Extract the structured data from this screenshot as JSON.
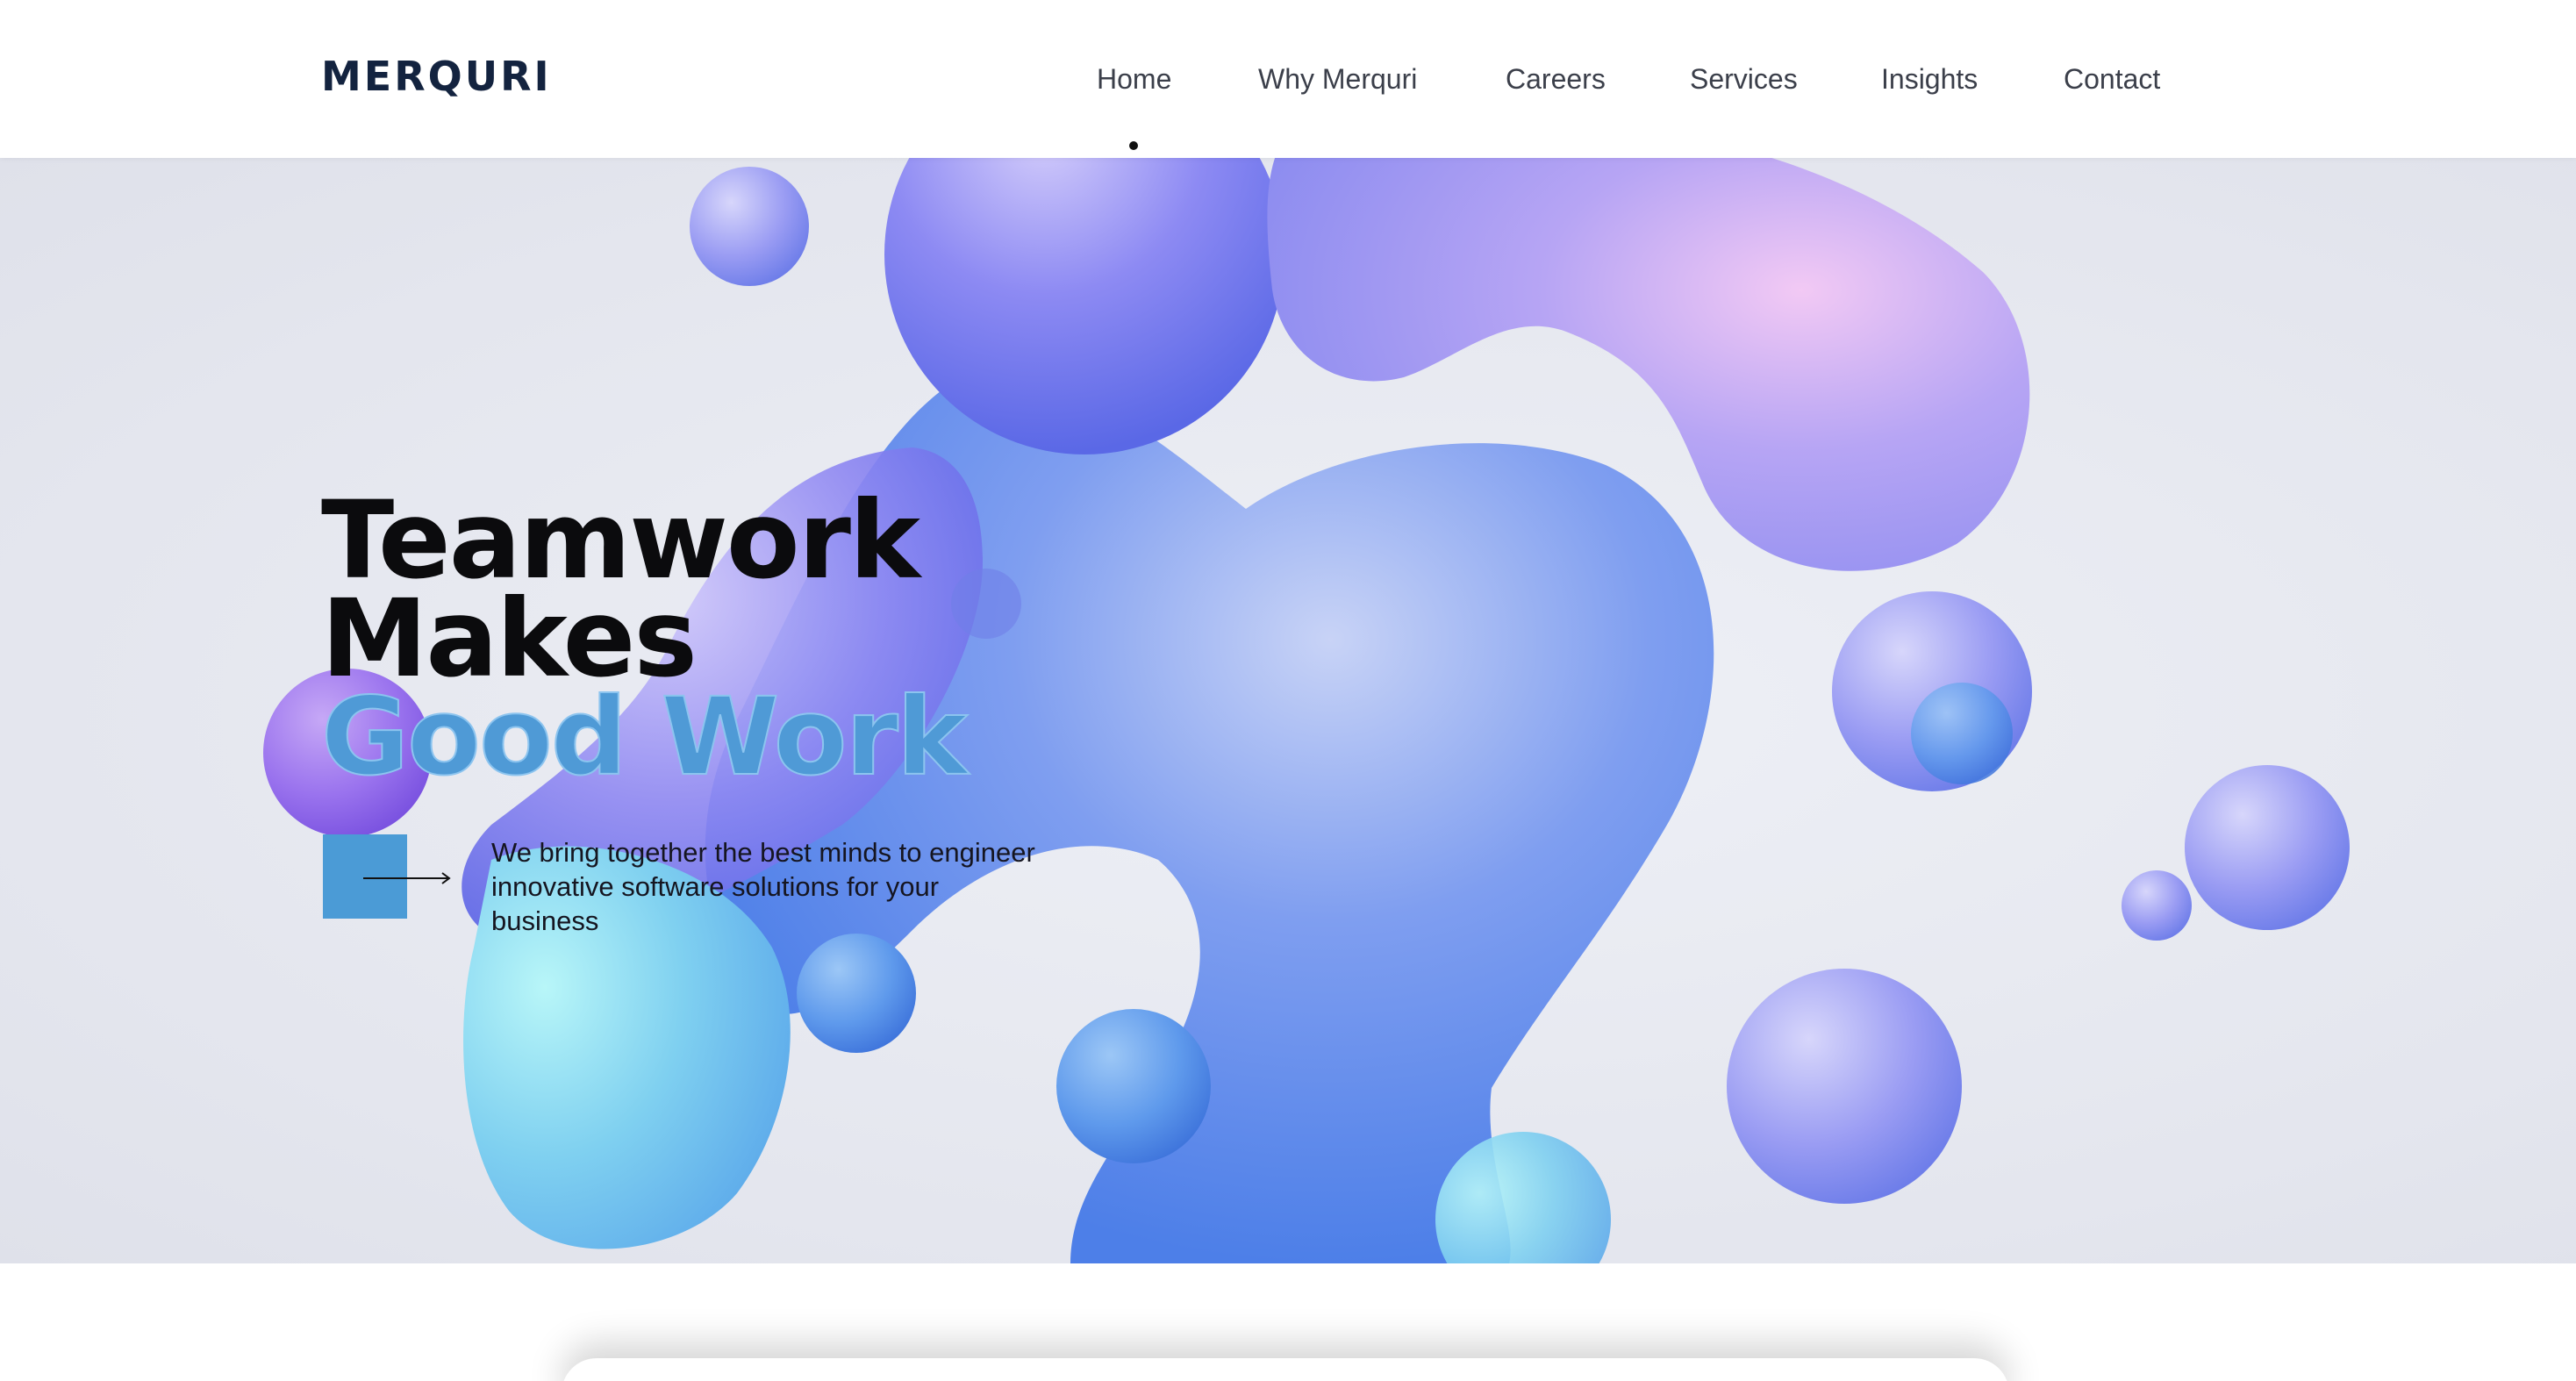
{
  "brand": {
    "logo_text": "MERQURI"
  },
  "nav": {
    "items": [
      {
        "label": "Home",
        "active": true
      },
      {
        "label": "Why Merquri",
        "active": false
      },
      {
        "label": "Careers",
        "active": false
      },
      {
        "label": "Services",
        "active": false
      },
      {
        "label": "Insights",
        "active": false
      },
      {
        "label": "Contact",
        "active": false
      }
    ]
  },
  "hero": {
    "headline_line1": "Teamwork",
    "headline_line2": "Makes",
    "headline_accent": "Good Work",
    "tagline": "We bring together the best minds to engineer innovative software solutions for your business",
    "cta_icon": "arrow-right-icon"
  },
  "colors": {
    "brand_navy": "#13233f",
    "accent_blue": "#4b9bd6",
    "blob_purple": "#8b7cf0",
    "blob_blue": "#5b8ff0",
    "blob_cyan": "#7fe0f0"
  }
}
